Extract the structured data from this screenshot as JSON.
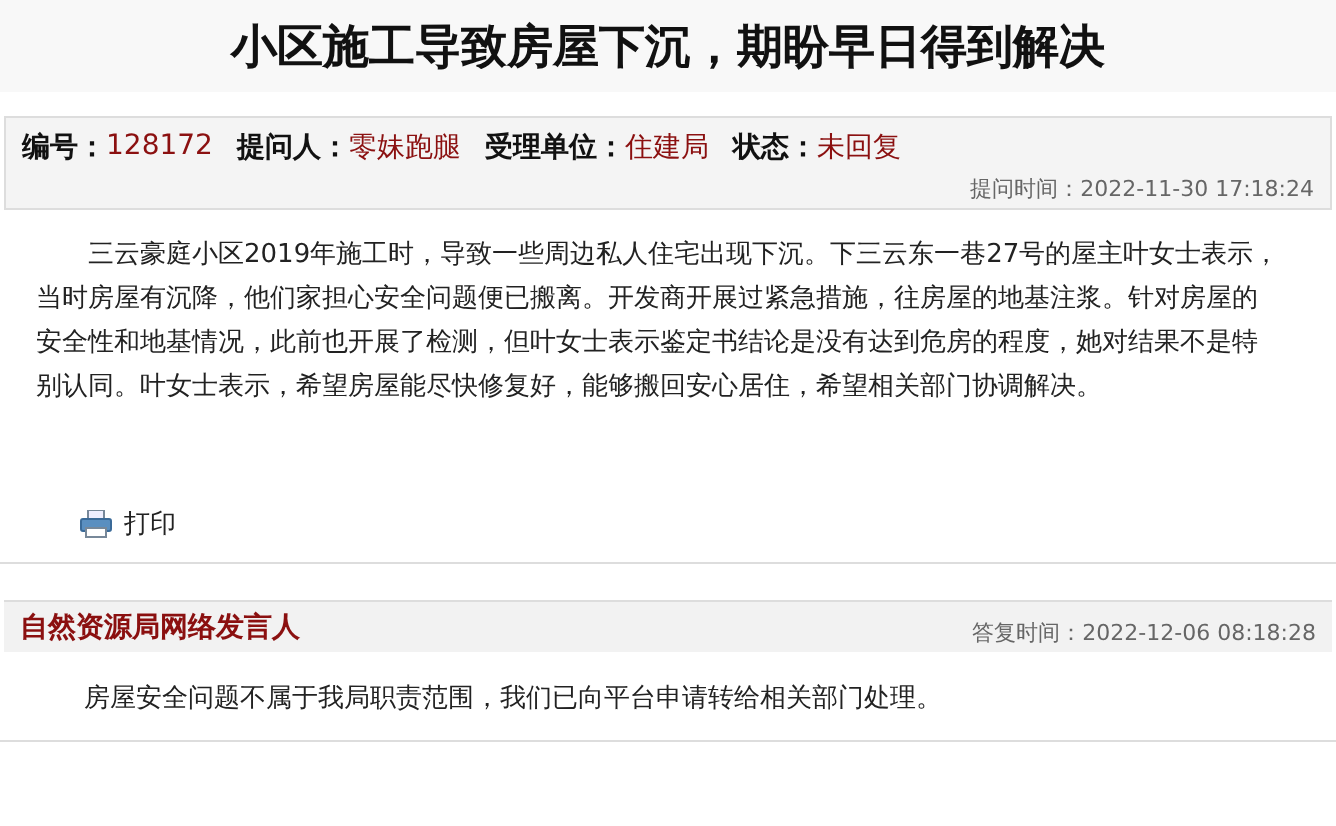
{
  "title": "小区施工导致房屋下沉，期盼早日得到解决",
  "meta": [
    {
      "label": "编号：",
      "value": "128172"
    },
    {
      "label": "提问人：",
      "value": "零妹跑腿"
    },
    {
      "label": "受理单位：",
      "value": "住建局"
    },
    {
      "label": "状态：",
      "value": "未回复"
    }
  ],
  "ask_time": "提问时间：2022-11-30 17:18:24",
  "question": "三云豪庭小区2019年施工时，导致一些周边私人住宅出现下沉。下三云东一巷27号的屋主叶女士表示，当时房屋有沉降，他们家担心安全问题便已搬离。开发商开展过紧急措施，往房屋的地基注浆。针对房屋的安全性和地基情况，此前也开展了检测，但叶女士表示鉴定书结论是没有达到危房的程度，她对结果不是特别认同。叶女士表示，希望房屋能尽快修复好，能够搬回安心居住，希望相关部门协调解决。",
  "print": "打印",
  "reply": {
    "author": "自然资源局网络发言人",
    "time": "答复时间：2022-12-06 08:18:28",
    "text": "房屋安全问题不属于我局职责范围，我们已向平台申请转给相关部门处理。"
  }
}
